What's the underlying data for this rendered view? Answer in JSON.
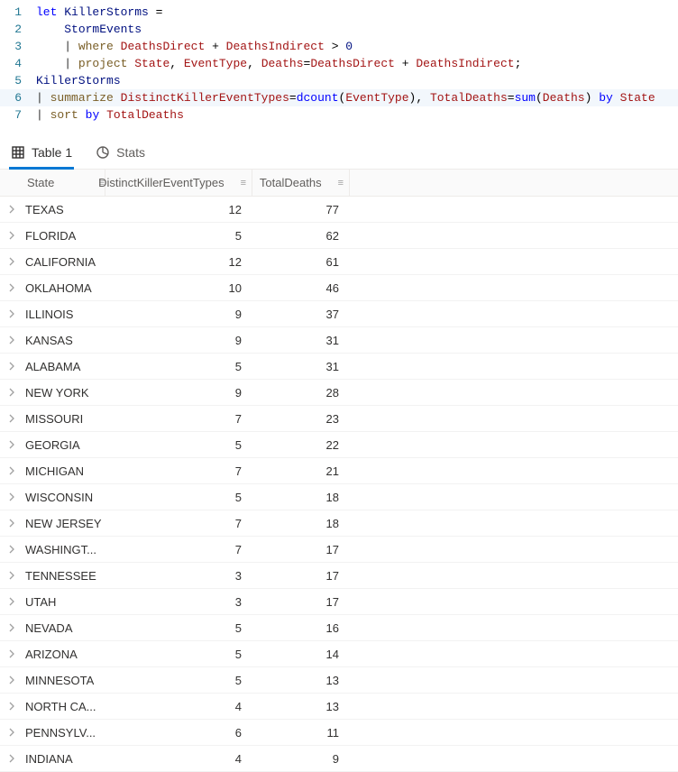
{
  "editor": {
    "lines": [
      {
        "num": "1",
        "hl": false,
        "tokens": [
          {
            "t": "let ",
            "c": "kw"
          },
          {
            "t": "KillerStorms",
            "c": "ident"
          },
          {
            "t": " =",
            "c": "plain"
          }
        ]
      },
      {
        "num": "2",
        "hl": false,
        "tokens": [
          {
            "t": "    ",
            "c": "plain"
          },
          {
            "t": "StormEvents",
            "c": "ident"
          }
        ]
      },
      {
        "num": "3",
        "hl": false,
        "tokens": [
          {
            "t": "    | ",
            "c": "pipe"
          },
          {
            "t": "where",
            "c": "func"
          },
          {
            "t": " ",
            "c": "plain"
          },
          {
            "t": "DeathsDirect",
            "c": "col"
          },
          {
            "t": " + ",
            "c": "plain"
          },
          {
            "t": "DeathsIndirect",
            "c": "col"
          },
          {
            "t": " > ",
            "c": "plain"
          },
          {
            "t": "0",
            "c": "ident"
          }
        ]
      },
      {
        "num": "4",
        "hl": false,
        "tokens": [
          {
            "t": "    | ",
            "c": "pipe"
          },
          {
            "t": "project",
            "c": "func"
          },
          {
            "t": " ",
            "c": "plain"
          },
          {
            "t": "State",
            "c": "col"
          },
          {
            "t": ", ",
            "c": "plain"
          },
          {
            "t": "EventType",
            "c": "col"
          },
          {
            "t": ", ",
            "c": "plain"
          },
          {
            "t": "Deaths",
            "c": "col"
          },
          {
            "t": "=",
            "c": "plain"
          },
          {
            "t": "DeathsDirect",
            "c": "col"
          },
          {
            "t": " + ",
            "c": "plain"
          },
          {
            "t": "DeathsIndirect",
            "c": "col"
          },
          {
            "t": ";",
            "c": "plain"
          }
        ]
      },
      {
        "num": "5",
        "hl": false,
        "tokens": [
          {
            "t": "KillerStorms",
            "c": "ident"
          }
        ]
      },
      {
        "num": "6",
        "hl": true,
        "tokens": [
          {
            "t": "| ",
            "c": "pipe"
          },
          {
            "t": "summarize",
            "c": "func"
          },
          {
            "t": " ",
            "c": "plain"
          },
          {
            "t": "DistinctKillerEventTypes",
            "c": "col"
          },
          {
            "t": "=",
            "c": "plain"
          },
          {
            "t": "dcount",
            "c": "kw"
          },
          {
            "t": "(",
            "c": "plain"
          },
          {
            "t": "EventType",
            "c": "col"
          },
          {
            "t": "), ",
            "c": "plain"
          },
          {
            "t": "TotalDeaths",
            "c": "col"
          },
          {
            "t": "=",
            "c": "plain"
          },
          {
            "t": "sum",
            "c": "kw"
          },
          {
            "t": "(",
            "c": "plain"
          },
          {
            "t": "Deaths",
            "c": "col"
          },
          {
            "t": ") ",
            "c": "plain"
          },
          {
            "t": "by",
            "c": "kw"
          },
          {
            "t": " ",
            "c": "plain"
          },
          {
            "t": "State",
            "c": "col"
          }
        ]
      },
      {
        "num": "7",
        "hl": false,
        "tokens": [
          {
            "t": "| ",
            "c": "pipe"
          },
          {
            "t": "sort",
            "c": "func"
          },
          {
            "t": " ",
            "c": "plain"
          },
          {
            "t": "by",
            "c": "kw"
          },
          {
            "t": " ",
            "c": "plain"
          },
          {
            "t": "TotalDeaths",
            "c": "col"
          }
        ]
      }
    ]
  },
  "tabs": {
    "table": "Table 1",
    "stats": "Stats"
  },
  "columns": {
    "state": "State",
    "types": "DistinctKillerEventTypes",
    "deaths": "TotalDeaths"
  },
  "rows": [
    {
      "state": "TEXAS",
      "types": "12",
      "deaths": "77"
    },
    {
      "state": "FLORIDA",
      "types": "5",
      "deaths": "62"
    },
    {
      "state": "CALIFORNIA",
      "types": "12",
      "deaths": "61"
    },
    {
      "state": "OKLAHOMA",
      "types": "10",
      "deaths": "46"
    },
    {
      "state": "ILLINOIS",
      "types": "9",
      "deaths": "37"
    },
    {
      "state": "KANSAS",
      "types": "9",
      "deaths": "31"
    },
    {
      "state": "ALABAMA",
      "types": "5",
      "deaths": "31"
    },
    {
      "state": "NEW YORK",
      "types": "9",
      "deaths": "28"
    },
    {
      "state": "MISSOURI",
      "types": "7",
      "deaths": "23"
    },
    {
      "state": "GEORGIA",
      "types": "5",
      "deaths": "22"
    },
    {
      "state": "MICHIGAN",
      "types": "7",
      "deaths": "21"
    },
    {
      "state": "WISCONSIN",
      "types": "5",
      "deaths": "18"
    },
    {
      "state": "NEW JERSEY",
      "types": "7",
      "deaths": "18"
    },
    {
      "state": "WASHINGT...",
      "types": "7",
      "deaths": "17"
    },
    {
      "state": "TENNESSEE",
      "types": "3",
      "deaths": "17"
    },
    {
      "state": "UTAH",
      "types": "3",
      "deaths": "17"
    },
    {
      "state": "NEVADA",
      "types": "5",
      "deaths": "16"
    },
    {
      "state": "ARIZONA",
      "types": "5",
      "deaths": "14"
    },
    {
      "state": "MINNESOTA",
      "types": "5",
      "deaths": "13"
    },
    {
      "state": "NORTH CA...",
      "types": "4",
      "deaths": "13"
    },
    {
      "state": "PENNSYLV...",
      "types": "6",
      "deaths": "11"
    },
    {
      "state": "INDIANA",
      "types": "4",
      "deaths": "9"
    }
  ]
}
